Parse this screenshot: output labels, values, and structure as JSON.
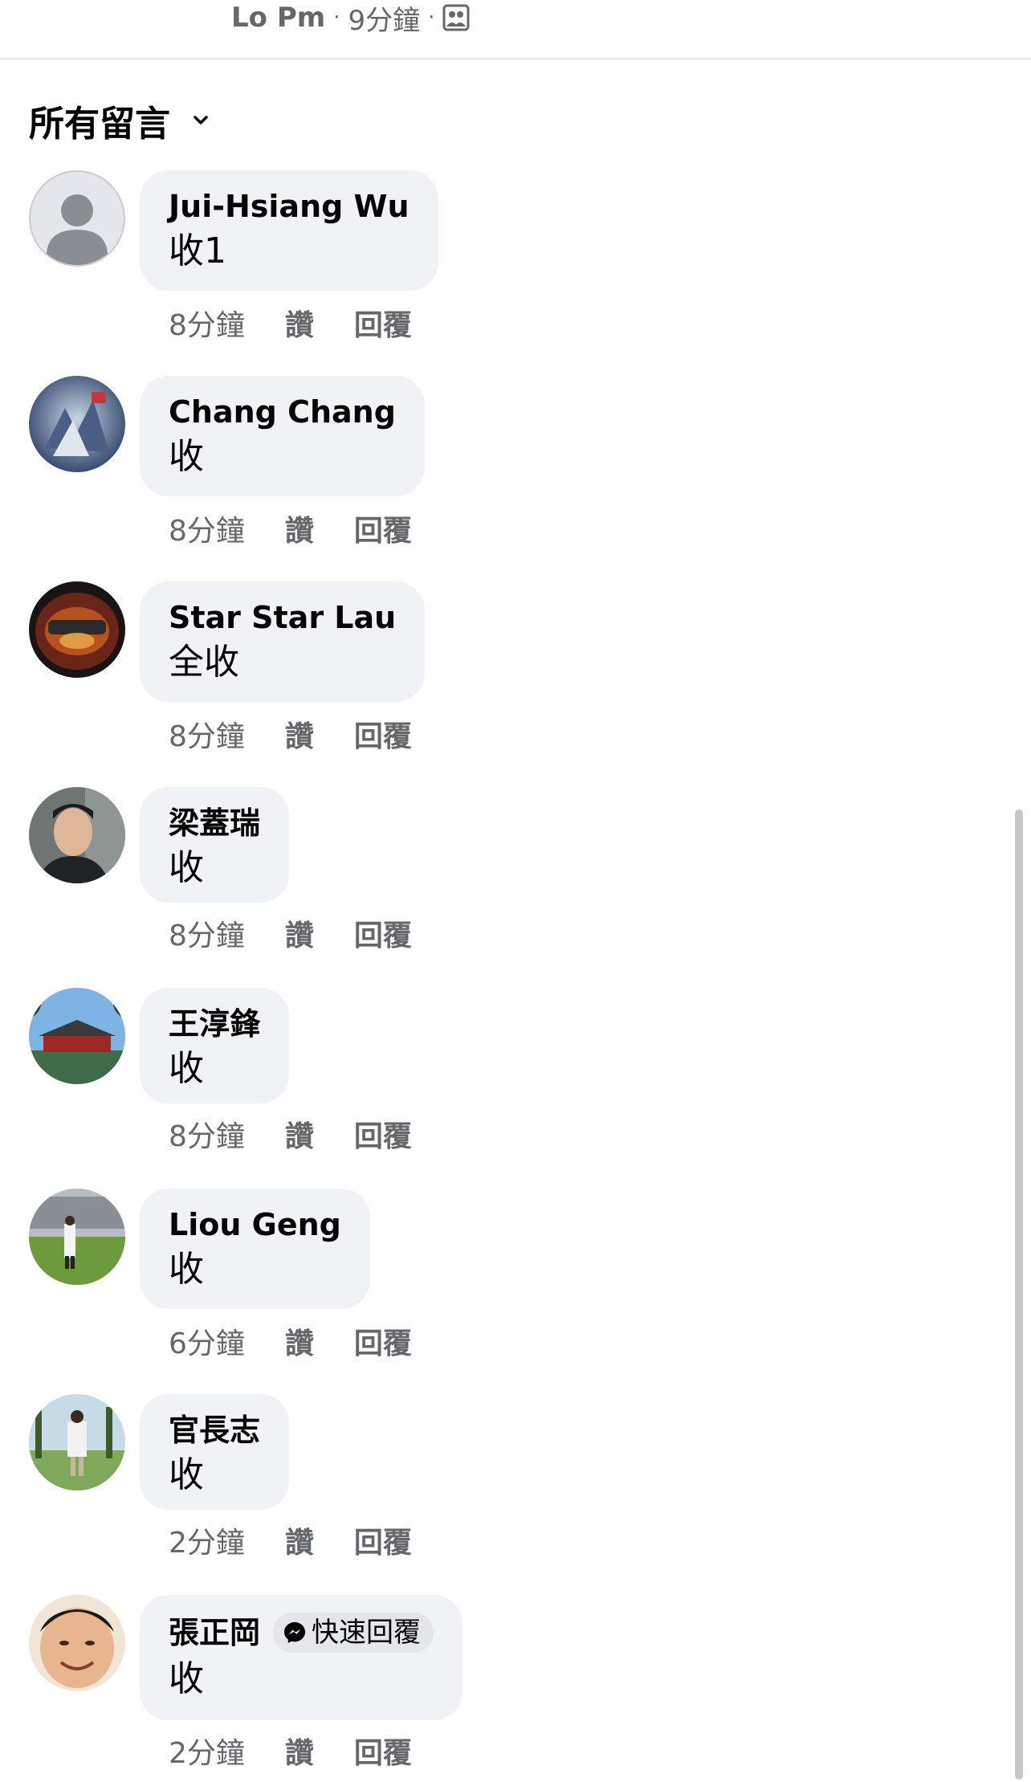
{
  "post": {
    "author": "Lo Pm",
    "sep1": "·",
    "time": "9分鐘",
    "sep2": "·"
  },
  "section": {
    "title": "所有留言"
  },
  "comments": [
    {
      "name": "Jui-Hsiang Wu",
      "text": "收1",
      "time": "8分鐘",
      "like": "讚",
      "reply": "回覆"
    },
    {
      "name": "Chang Chang",
      "text": "收",
      "time": "8分鐘",
      "like": "讚",
      "reply": "回覆"
    },
    {
      "name": "Star Star Lau",
      "text": "全收",
      "time": "8分鐘",
      "like": "讚",
      "reply": "回覆"
    },
    {
      "name": "梁蓋瑞",
      "text": "收",
      "time": "8分鐘",
      "like": "讚",
      "reply": "回覆"
    },
    {
      "name": "王淳鋒",
      "text": "收",
      "time": "8分鐘",
      "like": "讚",
      "reply": "回覆"
    },
    {
      "name": "Liou Geng",
      "text": "收",
      "time": "6分鐘",
      "like": "讚",
      "reply": "回覆"
    },
    {
      "name": "官長志",
      "text": "收",
      "time": "2分鐘",
      "like": "讚",
      "reply": "回覆"
    },
    {
      "name": "張正岡",
      "badge": "快速回覆",
      "text": "收",
      "time": "2分鐘",
      "like": "讚",
      "reply": "回覆"
    }
  ],
  "colors": {
    "bubble": "#f0f2f5",
    "meta_text": "#65676b",
    "messenger_blue": "#0866ff"
  }
}
